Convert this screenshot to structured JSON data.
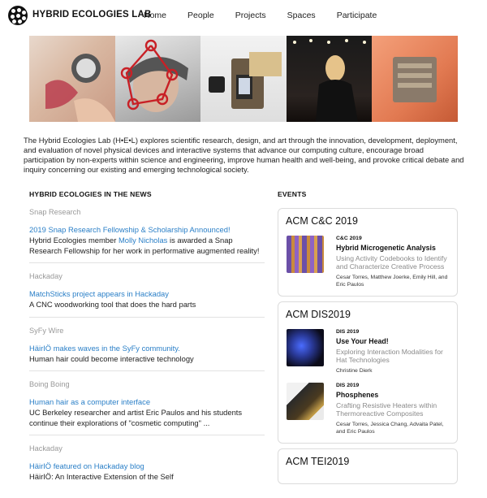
{
  "header": {
    "brand": "HYBRID ECOLOGIES LAB",
    "nav": [
      "Home",
      "People",
      "Projects",
      "Spaces",
      "Participate"
    ]
  },
  "banner_images": [
    "hand-watch-photo",
    "face-tracking-photo",
    "device-photo",
    "performer-photo",
    "skin-chip-photo"
  ],
  "intro": "The Hybrid Ecologies Lab (H•E•L) explores scientific research, design, and art through the innovation, development, deployment, and evaluation of novel physical devices and interactive systems that advance our computing culture, encourage broad participation by non-experts within science and engineering, improve human health and well-being, and provoke critical debate and inquiry concerning our existing and emerging technological society.",
  "news": {
    "title": "HYBRID ECOLOGIES IN THE NEWS",
    "items": [
      {
        "source": "Snap Research",
        "link": "2019 Snap Research Fellowship & Scholarship Announced!",
        "desc_pre": "Hybrid Ecologies member ",
        "desc_link": "Molly Nicholas",
        "desc_post": " is awarded a Snap Research Fellowship for her work in performative augmented reality!"
      },
      {
        "source": "Hackaday",
        "link": "MatchSticks project appears in Hackaday",
        "desc": "A CNC woodworking tool that does the hard parts"
      },
      {
        "source": "SyFy Wire",
        "link": "HäirIÖ makes waves in the SyFy community.",
        "desc": "Human hair could become interactive technology"
      },
      {
        "source": "Boing Boing",
        "link": "Human hair as a computer interface",
        "desc": "UC Berkeley researcher and artist Eric Paulos and his students continue their explorations of \"cosmetic computing\" ..."
      },
      {
        "source": "Hackaday",
        "link": "HäirIÖ featured on Hackaday blog",
        "desc": "HäirIÖ: An Interactive Extension of the Self"
      }
    ]
  },
  "events": {
    "title": "EVENTS",
    "cards": [
      {
        "heading": "ACM C&C 2019",
        "entries": [
          {
            "venue": "C&C 2019",
            "title": "Hybrid Microgenetic Analysis",
            "subtitle": "Using Activity Codebooks to Identify and Characterize Creative Process",
            "authors": "Cesar Torres, Matthew Joerke, Emily Hill, and Eric Paulos"
          }
        ]
      },
      {
        "heading": "ACM DIS2019",
        "entries": [
          {
            "venue": "DIS 2019",
            "title": "Use Your Head!",
            "subtitle": "Exploring Interaction Modalities for Hat Technologies",
            "authors": "Christine Dierk"
          },
          {
            "venue": "DIS 2019",
            "title": "Phosphenes",
            "subtitle": "Crafting Resistive Heaters within Thermoreactive Composites",
            "authors": "Cesar Torres, Jessica Chang, Advaita Patel, and Eric Paulos"
          }
        ]
      },
      {
        "heading": "ACM TEI2019",
        "entries": []
      }
    ]
  }
}
